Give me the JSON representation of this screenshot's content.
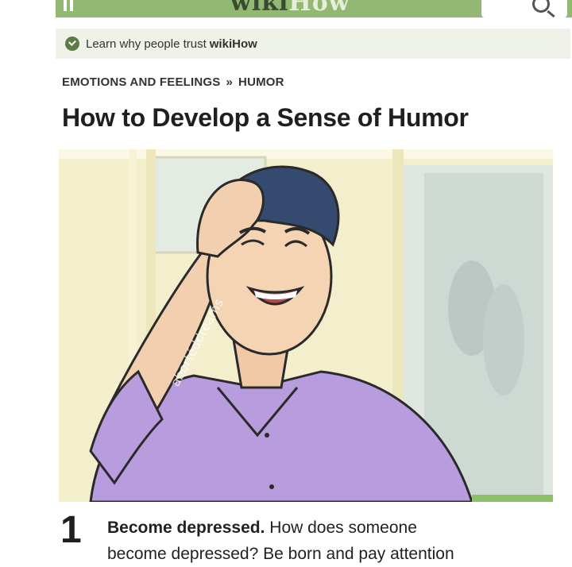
{
  "header": {
    "logo_word_1": "wiki",
    "logo_word_2": "How",
    "menu_icon": "hamburger-menu-icon",
    "search_icon": "magnifier-icon",
    "bar_color": "#93b874"
  },
  "trust_banner": {
    "text_prefix": "Learn why people trust",
    "text_brand": "wikiHow"
  },
  "breadcrumb": {
    "items": [
      "EMOTIONS AND FEELINGS",
      "HUMOR"
    ],
    "separator": "»"
  },
  "article": {
    "title": "How to Develop a Sense of Humor",
    "illustration_watermark": "abortéddreams",
    "step": {
      "number": "1",
      "heading": "Become depressed.",
      "line1_rest": "How does someone",
      "line2": "become depressed? Be born and pay attention"
    }
  }
}
